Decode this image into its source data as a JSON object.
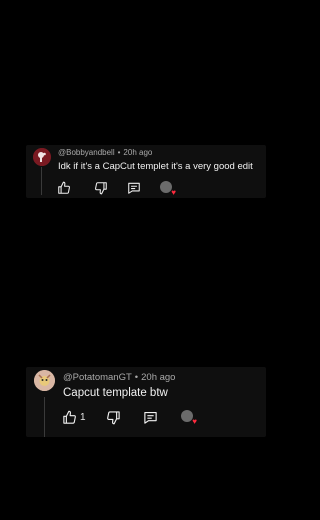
{
  "colors": {
    "background": "#000000",
    "card": "#0f0f0f",
    "text": "#f1f1f1",
    "meta": "#aaaaaa",
    "heart": "#ff2a3d"
  },
  "comments": [
    {
      "author": "@Bobbyandbell",
      "separator": "•",
      "time": "20h ago",
      "text": "Idk if it's a CapCut templet it's a very good edit",
      "likes": "",
      "icons": [
        "like-icon",
        "dislike-icon",
        "reply-icon",
        "creator-heart-icon"
      ]
    },
    {
      "author": "@PotatomanGT",
      "separator": "•",
      "time": "20h ago",
      "text": "Capcut template btw",
      "likes": "1",
      "icons": [
        "like-icon",
        "dislike-icon",
        "reply-icon",
        "creator-heart-icon"
      ]
    }
  ]
}
